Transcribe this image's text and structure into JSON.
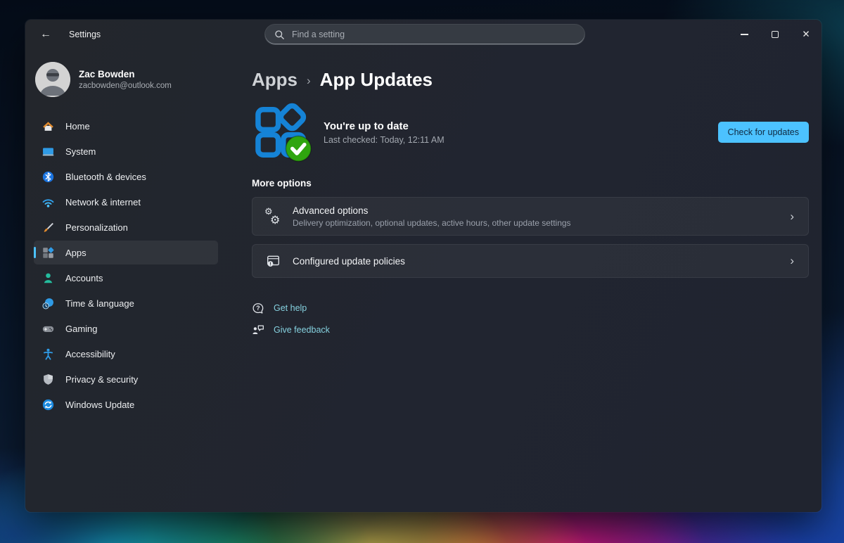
{
  "icons": {
    "back": "←",
    "close": "✕",
    "chevron": "›",
    "gear": "⚙"
  },
  "titlebar": {
    "app_title": "Settings",
    "search_placeholder": "Find a setting"
  },
  "user": {
    "name": "Zac Bowden",
    "email": "zacbowden@outlook.com"
  },
  "sidebar": {
    "items": [
      {
        "label": "Home"
      },
      {
        "label": "System"
      },
      {
        "label": "Bluetooth & devices"
      },
      {
        "label": "Network & internet"
      },
      {
        "label": "Personalization"
      },
      {
        "label": "Apps",
        "selected": true
      },
      {
        "label": "Accounts"
      },
      {
        "label": "Time & language"
      },
      {
        "label": "Gaming"
      },
      {
        "label": "Accessibility"
      },
      {
        "label": "Privacy & security"
      },
      {
        "label": "Windows Update"
      }
    ]
  },
  "breadcrumb": {
    "parent": "Apps",
    "separator": "›",
    "current": "App Updates"
  },
  "hero": {
    "title": "You're up to date",
    "subtitle": "Last checked: Today, 12:11 AM",
    "button_label": "Check for updates"
  },
  "more_options": {
    "heading": "More options",
    "rows": [
      {
        "title": "Advanced options",
        "subtitle": "Delivery optimization, optional updates, active hours, other update settings"
      },
      {
        "title": "Configured update policies"
      }
    ]
  },
  "footer_links": [
    {
      "label": "Get help"
    },
    {
      "label": "Give feedback"
    }
  ],
  "colors": {
    "accent": "#4cc2ff",
    "link": "#86d1df",
    "success_green": "#2fa50f",
    "app_icon_blue": "#1583d6"
  }
}
